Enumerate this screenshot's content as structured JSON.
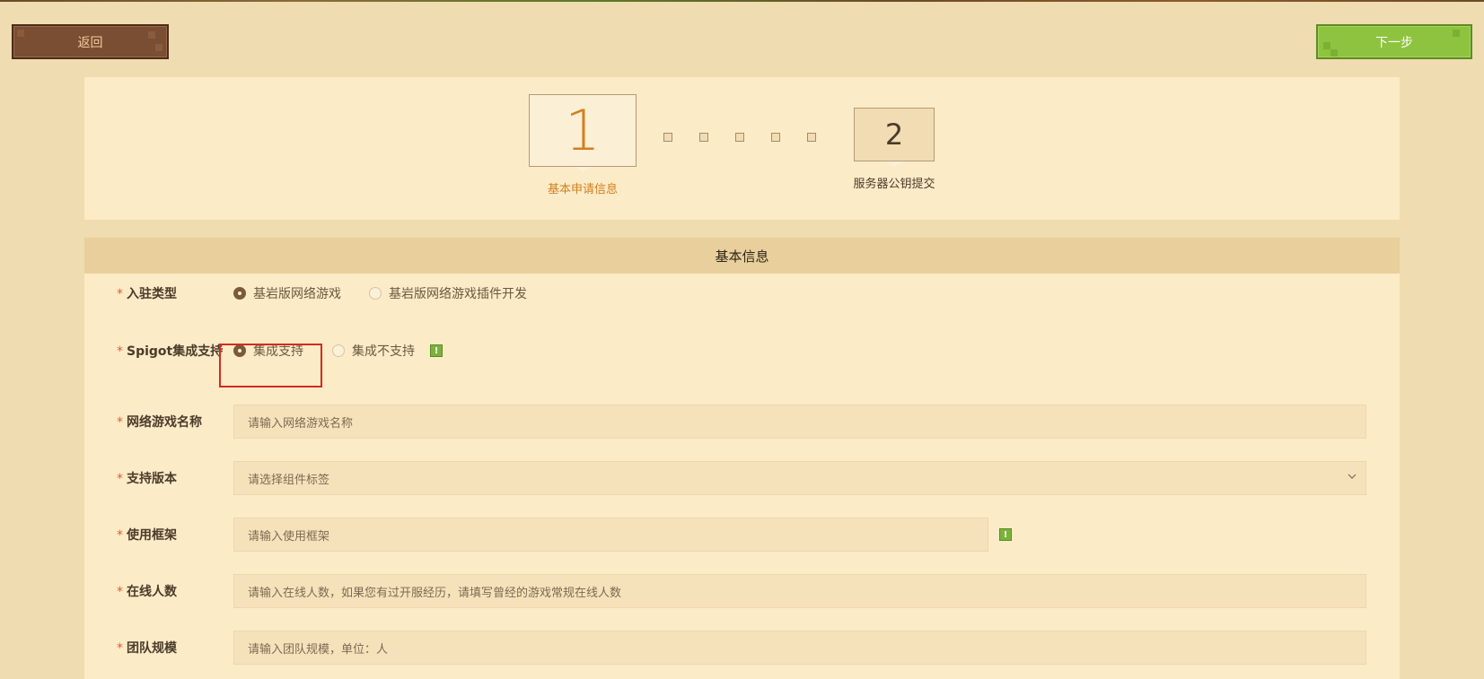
{
  "nav": {
    "back_label": "返回",
    "next_label": "下一步"
  },
  "steps": [
    {
      "number": "1",
      "label": "基本申请信息"
    },
    {
      "number": "2",
      "label": "服务器公钥提交"
    }
  ],
  "section_title": "基本信息",
  "form": {
    "entry_type": {
      "label": "入驻类型",
      "options": [
        "基岩版网络游戏",
        "基岩版网络游戏插件开发"
      ],
      "selected": "基岩版网络游戏"
    },
    "spigot": {
      "label": "Spigot集成支持",
      "options": [
        "集成支持",
        "集成不支持"
      ],
      "selected": "集成支持"
    },
    "game_name": {
      "label": "网络游戏名称",
      "placeholder": "请输入网络游戏名称"
    },
    "version": {
      "label": "支持版本",
      "placeholder": "请选择组件标签"
    },
    "framework": {
      "label": "使用框架",
      "placeholder": "请输入使用框架"
    },
    "online": {
      "label": "在线人数",
      "placeholder": "请输入在线人数，如果您有过开服经历，请填写曾经的游戏常规在线人数"
    },
    "team": {
      "label": "团队规模",
      "placeholder": "请输入团队规模，单位：人"
    }
  },
  "required_mark": "*",
  "hint_mark": "!"
}
